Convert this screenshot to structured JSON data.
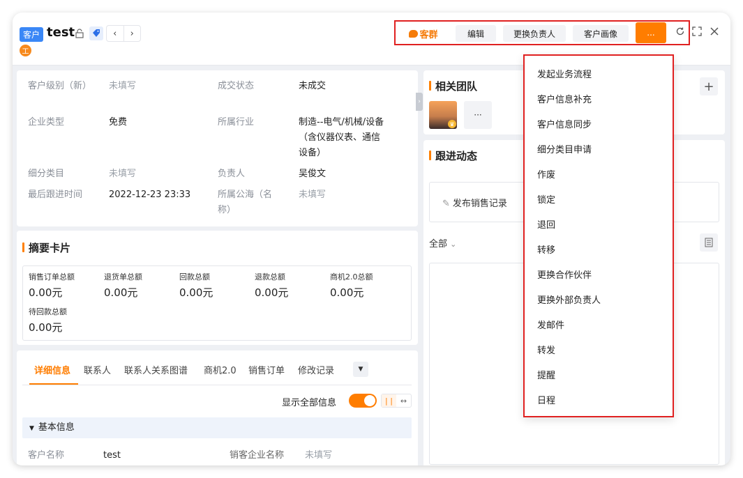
{
  "header": {
    "type_badge": "客户",
    "title": "test",
    "owner_initial": "工",
    "actions": {
      "group_chat": "客群",
      "edit": "编辑",
      "change_owner": "更换负责人",
      "portrait": "客户画像",
      "more": "..."
    }
  },
  "info": {
    "fields": [
      {
        "label": "客户级别（新）",
        "value": "未填写"
      },
      {
        "label": "成交状态",
        "value": "未成交"
      },
      {
        "label": "企业类型",
        "value": "免费"
      },
      {
        "label": "所属行业",
        "value": "制造--电气/机械/设备（含仪器仪表、通信设备）"
      },
      {
        "label": "细分类目",
        "value": "未填写"
      },
      {
        "label": "负责人",
        "value": "吴俊文"
      },
      {
        "label": "最后跟进时间",
        "value": "2022-12-23 23:33"
      },
      {
        "label": "所属公海（名称）",
        "value": "未填写"
      }
    ]
  },
  "summary": {
    "title": "摘要卡片",
    "items": [
      {
        "label": "销售订单总额",
        "value": "0.00元"
      },
      {
        "label": "退货单总额",
        "value": "0.00元"
      },
      {
        "label": "回款总额",
        "value": "0.00元"
      },
      {
        "label": "退款总额",
        "value": "0.00元"
      },
      {
        "label": "商机2.0总额",
        "value": "0.00元"
      },
      {
        "label": "待回款总额",
        "value": "0.00元"
      }
    ]
  },
  "detail": {
    "tabs": [
      "详细信息",
      "联系人",
      "联系人关系图谱",
      "商机2.0",
      "销售订单",
      "修改记录"
    ],
    "show_all_label": "显示全部信息",
    "basic_section": "基本信息",
    "fields": [
      {
        "label": "客户名称",
        "value": "test"
      },
      {
        "label": "销客企业名称",
        "value": "未填写"
      }
    ]
  },
  "team": {
    "title": "相关团队",
    "more": "···"
  },
  "followup": {
    "title": "跟进动态",
    "publish_label": "发布销售记录",
    "filter_label": "全部"
  },
  "more_menu": {
    "items": [
      "发起业务流程",
      "客户信息补充",
      "客户信息同步",
      "细分类目申请",
      "作废",
      "锁定",
      "退回",
      "转移",
      "更换合作伙伴",
      "更换外部负责人",
      "发邮件",
      "转发",
      "提醒",
      "日程"
    ]
  },
  "colors": {
    "accent": "#ff7d00",
    "highlight": "#e02020",
    "badge": "#3a87f6"
  }
}
